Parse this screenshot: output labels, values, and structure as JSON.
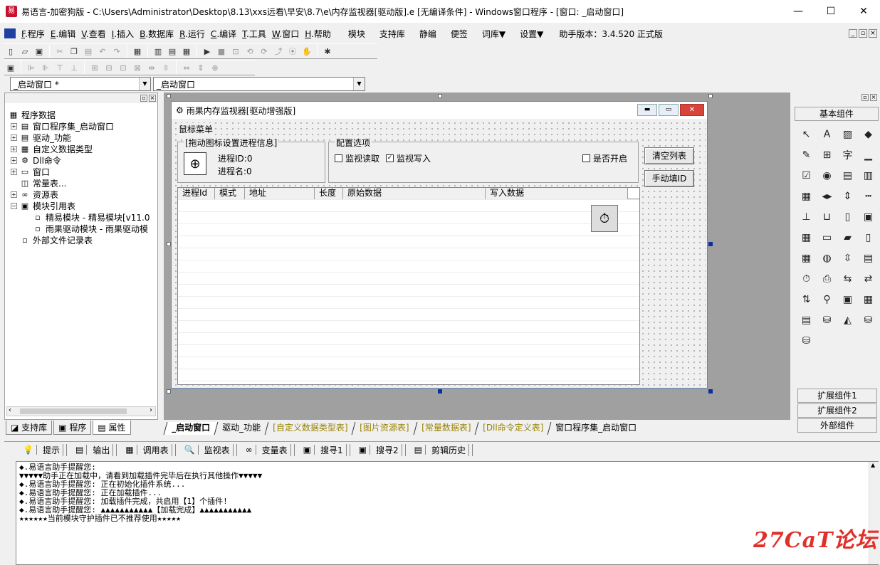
{
  "window": {
    "title": "易语言-加密狗版 - C:\\Users\\Administrator\\Desktop\\8.13\\xxs远看\\早安\\8.7\\e\\内存监视器[驱动版].e [无编译条件] - Windows窗口程序 - [窗口: _启动窗口]",
    "minimize": "—",
    "maximize": "☐",
    "close": "✕"
  },
  "menu": {
    "items": [
      {
        "key": "F",
        "label": ".程序"
      },
      {
        "key": "E",
        "label": ".编辑"
      },
      {
        "key": "V",
        "label": ".查看"
      },
      {
        "key": "I",
        "label": ".插入"
      },
      {
        "key": "B",
        "label": ".数据库"
      },
      {
        "key": "R",
        "label": ".运行"
      },
      {
        "key": "C",
        "label": ".编译"
      },
      {
        "key": "T",
        "label": ".工具"
      },
      {
        "key": "W",
        "label": ".窗口"
      },
      {
        "key": "H",
        "label": ".帮助"
      }
    ],
    "extra": [
      "模块",
      "支持库",
      "静编",
      "便签",
      "词库▼",
      "设置▼"
    ],
    "version": "助手版本：3.4.520 正式版"
  },
  "combos": {
    "left": "_启动窗口 *",
    "right": "_启动窗口"
  },
  "tree": {
    "root": "程序数据",
    "items": [
      {
        "label": "窗口程序集_启动窗口",
        "pm": "+",
        "icon": "▤",
        "indent": 1
      },
      {
        "label": "驱动_功能",
        "pm": "+",
        "icon": "▤",
        "indent": 1
      },
      {
        "label": "自定义数据类型",
        "pm": "+",
        "icon": "▦",
        "indent": 1
      },
      {
        "label": "Dll命令",
        "pm": "+",
        "icon": "⚙",
        "indent": 1
      },
      {
        "label": "窗口",
        "pm": "+",
        "icon": "▭",
        "indent": 1
      },
      {
        "label": "常量表...",
        "pm": "",
        "icon": "◫",
        "indent": 1
      },
      {
        "label": "资源表",
        "pm": "+",
        "icon": "∞",
        "indent": 1
      },
      {
        "label": "模块引用表",
        "pm": "−",
        "icon": "▣",
        "indent": 1
      },
      {
        "label": "精易模块 - 精易模块[v11.0",
        "pm": "",
        "icon": "▫",
        "indent": 2
      },
      {
        "label": "雨果驱动模块 - 雨果驱动模",
        "pm": "",
        "icon": "▫",
        "indent": 2
      },
      {
        "label": "外部文件记录表",
        "pm": "",
        "icon": "▫",
        "indent": 1
      }
    ]
  },
  "left_tabs": [
    "支持库",
    "程序",
    "属性"
  ],
  "form": {
    "title": "雨果内存监视器[驱动增强版]",
    "menu": "鼠标菜单",
    "group1": {
      "legend": "[拖动图标设置进程信息]",
      "pid": "进程ID:0",
      "pname": "进程名:0"
    },
    "group2": {
      "legend": "配置选项",
      "cb1": "监视读取",
      "cb2": "监视写入",
      "cb3": "是否开启"
    },
    "btn_clear": "清空列表",
    "btn_fill": "手动填ID",
    "columns": [
      "进程Id",
      "模式",
      "地址",
      "长度",
      "原始数据",
      "写入数据"
    ]
  },
  "bottom_tabs": [
    {
      "label": "_启动窗口",
      "style": "active"
    },
    {
      "label": "驱动_功能",
      "style": "normal"
    },
    {
      "label": "[自定义数据类型表]",
      "style": "gold"
    },
    {
      "label": "[图片资源表]",
      "style": "gold"
    },
    {
      "label": "[常量数据表]",
      "style": "gold"
    },
    {
      "label": "[Dll命令定义表]",
      "style": "gold"
    },
    {
      "label": "窗口程序集_启动窗口",
      "style": "normal"
    }
  ],
  "right_panel": {
    "basic": "基本组件",
    "ext1": "扩展组件1",
    "ext2": "扩展组件2",
    "external": "外部组件"
  },
  "output_tabs": [
    "提示",
    "输出",
    "调用表",
    "监视表",
    "变量表",
    "搜寻1",
    "搜寻2",
    "剪辑历史"
  ],
  "output_lines": [
    "◆.易语言助手提醒您:",
    "▼▼▼▼▼助手正在加载中，请看到加载插件完毕后在执行其他操作▼▼▼▼▼",
    "◆.易语言助手提醒您: 正在初始化插件系统...",
    "◆.易语言助手提醒您: 正在加载插件...",
    "◆.易语言助手提醒您: 加载插件完成，共启用【1】个插件!",
    "◆.易语言助手提醒您: ▲▲▲▲▲▲▲▲▲▲▲【加载完成】▲▲▲▲▲▲▲▲▲▲▲",
    "★★★★★★当前模块守护插件已不推荐使用★★★★★"
  ],
  "watermark": "27CaT论坛"
}
